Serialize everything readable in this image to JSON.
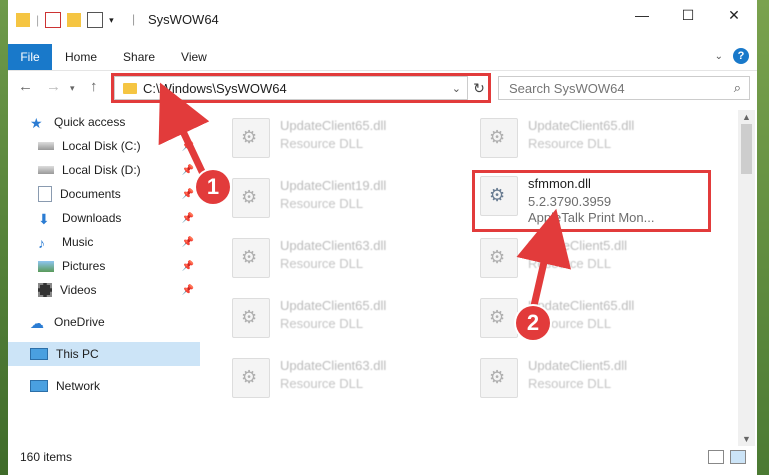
{
  "window": {
    "title": "SysWOW64",
    "controls": {
      "minimize": "—",
      "maximize": "☐",
      "close": "✕"
    }
  },
  "ribbon": {
    "tabs": [
      "File",
      "Home",
      "Share",
      "View"
    ],
    "help": "?"
  },
  "navigation": {
    "address_path": "C:\\Windows\\SysWOW64",
    "search_placeholder": "Search SysWOW64"
  },
  "sidebar": {
    "items": [
      {
        "label": "Quick access",
        "icon": "star-icon",
        "pinned": false
      },
      {
        "label": "Local Disk (C:)",
        "icon": "drive-icon",
        "pinned": true
      },
      {
        "label": "Local Disk (D:)",
        "icon": "drive-icon",
        "pinned": true
      },
      {
        "label": "Documents",
        "icon": "documents-icon",
        "pinned": true
      },
      {
        "label": "Downloads",
        "icon": "download-icon",
        "pinned": true
      },
      {
        "label": "Music",
        "icon": "music-icon",
        "pinned": true
      },
      {
        "label": "Pictures",
        "icon": "pictures-icon",
        "pinned": true
      },
      {
        "label": "Videos",
        "icon": "videos-icon",
        "pinned": true
      },
      {
        "label": "OneDrive",
        "icon": "cloud-icon",
        "pinned": false
      },
      {
        "label": "This PC",
        "icon": "computer-icon",
        "pinned": false
      },
      {
        "label": "Network",
        "icon": "network-icon",
        "pinned": false
      }
    ]
  },
  "files": {
    "left": [
      {
        "name": "UpdateClient65.dll",
        "desc": "Resource DLL"
      },
      {
        "name": "UpdateClient19.dll",
        "desc": "Resource DLL"
      },
      {
        "name": "UpdateClient63.dll",
        "desc": "Resource DLL"
      },
      {
        "name": "UpdateClient65.dll",
        "desc": "Resource DLL"
      },
      {
        "name": "UpdateClient63.dll",
        "desc": "Resource DLL"
      }
    ],
    "right": [
      {
        "name": "UpdateClient65.dll",
        "desc": "Resource DLL"
      },
      {
        "name": "UpdateClient5.dll",
        "desc": "Resource DLL"
      },
      {
        "name": "UpdateClient65.dll",
        "desc": "Resource DLL"
      },
      {
        "name": "UpdateClient5.dll",
        "desc": "Resource DLL"
      }
    ],
    "highlighted": {
      "name": "sfmmon.dll",
      "version": "5.2.3790.3959",
      "desc": "AppleTalk Print Mon..."
    }
  },
  "status": {
    "item_count": "160 items"
  },
  "annotations": {
    "step1": "1",
    "step2": "2",
    "color": "#e23b3b"
  }
}
